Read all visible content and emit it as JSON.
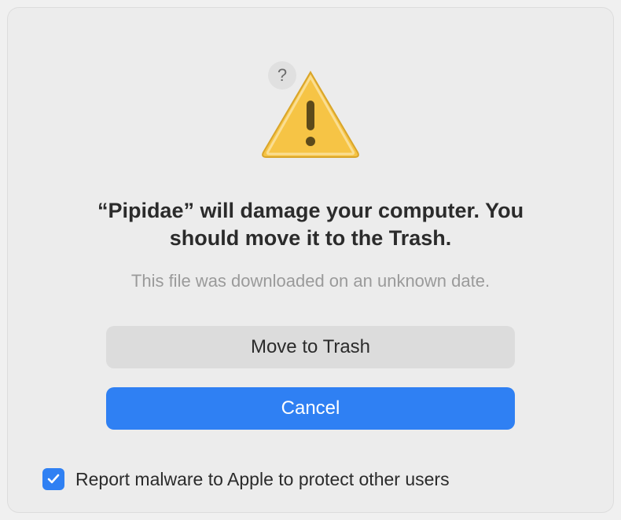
{
  "help_button_label": "?",
  "heading": "“Pipidae” will damage your computer. You should move it to the Trash.",
  "subtext": "This file was downloaded on an unknown date.",
  "buttons": {
    "move_to_trash": "Move to Trash",
    "cancel": "Cancel"
  },
  "checkbox": {
    "checked": true,
    "label": "Report malware to Apple to protect other users"
  },
  "colors": {
    "primary": "#2f80f3",
    "secondary": "#dcdcdc",
    "text_primary": "#2b2b2b",
    "text_muted": "#9a9a9a",
    "dialog_bg": "#ececec"
  }
}
